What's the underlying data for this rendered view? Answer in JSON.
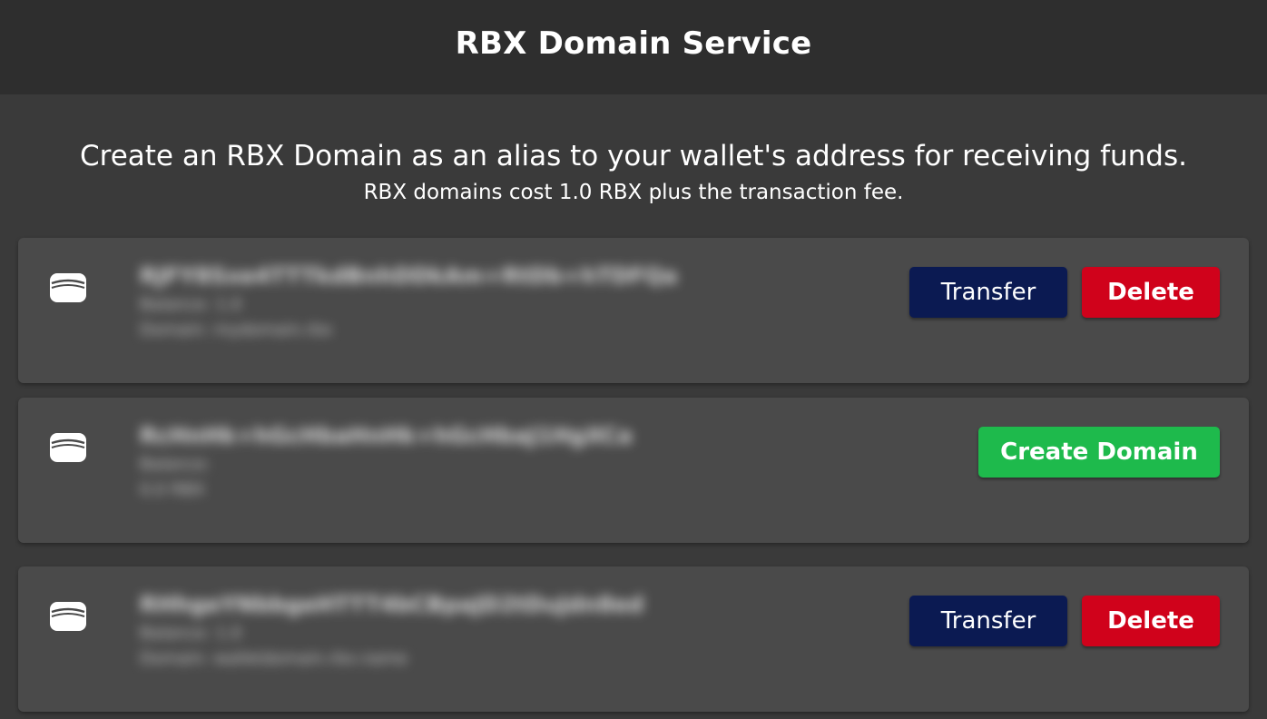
{
  "header": {
    "title": "RBX Domain Service"
  },
  "intro": {
    "main": "Create an RBX Domain as an alias to your wallet's address for receiving funds.",
    "sub": "RBX domains cost 1.0 RBX plus the transaction fee."
  },
  "colors": {
    "background": "#3a3a3a",
    "header": "#2e2e2e",
    "card": "#4a4a4a",
    "transfer_button": "#0b1a52",
    "delete_button": "#d0021b",
    "create_button": "#1eba4c"
  },
  "accounts": [
    {
      "icon": "wallet-icon",
      "address": "RJFY8Sxe4TTTkdBnhDDkAm+RtDb+hTDFQa",
      "line2": "Balance: 1.0",
      "line3": "Domain: mydomain.rbx",
      "actions": {
        "transfer_label": "Transfer",
        "delete_label": "Delete"
      }
    },
    {
      "icon": "wallet-icon",
      "address": "RcHnHk+hGcHbaHnHk+hGcHbaJ1HgXCa",
      "line2": "Balance:",
      "line3": "0.0 RBX",
      "actions": {
        "create_label": "Create Domain"
      }
    },
    {
      "icon": "wallet-icon",
      "address": "RHhgeYNbbgeHTTT4bCBpaJD2tDuJdn8ed",
      "line2": "Balance: 1.0",
      "line3": "Domain: walletdomain.rbx.name",
      "actions": {
        "transfer_label": "Transfer",
        "delete_label": "Delete"
      }
    }
  ]
}
